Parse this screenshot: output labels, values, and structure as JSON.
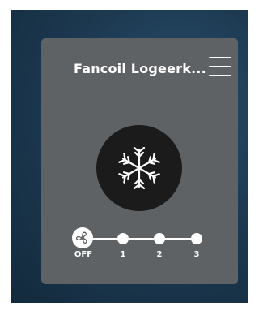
{
  "card": {
    "title": "Fancoil Logeerk...",
    "menu_icon": "hamburger-menu-icon"
  },
  "mode": {
    "icon": "snowflake-icon"
  },
  "fan_speed": {
    "icon": "fan-icon",
    "selected": "OFF",
    "levels": [
      "OFF",
      "1",
      "2",
      "3"
    ]
  }
}
